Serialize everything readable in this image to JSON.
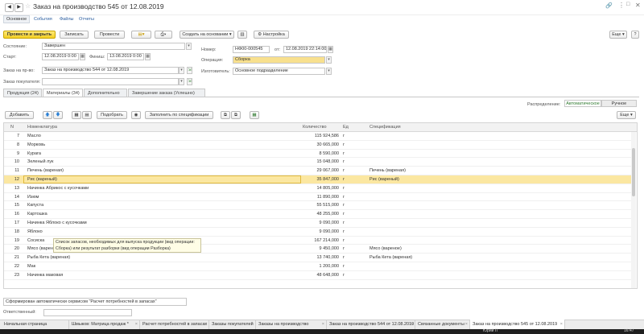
{
  "window": {
    "title": "Заказ на производство 545 от 12.08.2019"
  },
  "nav_tabs": [
    "Основное",
    "События",
    "Файлы",
    "Отчеты"
  ],
  "toolbar": {
    "post_close": "Провести и закрыть",
    "save": "Записать",
    "post": "Провести",
    "create_based": "Создать на основании",
    "settings": "Настройка",
    "more": "Еще"
  },
  "form": {
    "state_label": "Состояние:",
    "state_value": "Завершен",
    "start_label": "Старт:",
    "start_value": "12.08.2019  0:00",
    "finish_label": "Финиш:",
    "finish_value": "13.08.2019  0:00",
    "order_label": "Заказ на пр-во:",
    "order_value": "Заказ на производство 544 от 12.08.2019",
    "buyer_label": "Заказ покупателя:",
    "buyer_value": "",
    "number_label": "Номер:",
    "number_value": "НФ00-000545",
    "from_label": "от:",
    "from_value": "12.08.2019 22:14:00",
    "operation_label": "Операция:",
    "operation_value": "Сборка",
    "maker_label": "Изготовитель:",
    "maker_value": "Основное подразделение"
  },
  "content_tabs": [
    "Продукция (24)",
    "Материалы (34)",
    "Дополнительно",
    "Завершение заказа (Успешно)"
  ],
  "distribution": {
    "label": "Распределение:",
    "auto": "Автоматическое",
    "manual": "Ручное"
  },
  "table_toolbar": {
    "add": "Добавить",
    "pick": "Подобрать",
    "fill_spec": "Заполнить по спецификации",
    "more": "Еще"
  },
  "table": {
    "headers": {
      "n": "N",
      "name": "Номенклатура",
      "qty": "Количество",
      "unit": "Ед",
      "spec": "Спецификация"
    },
    "rows": [
      {
        "n": "7",
        "name": "Масло",
        "qty": "115 924,586",
        "unit": "г",
        "spec": ""
      },
      {
        "n": "8",
        "name": "Морковь",
        "qty": "30 665,000",
        "unit": "г",
        "spec": ""
      },
      {
        "n": "9",
        "name": "Курага",
        "qty": "8 590,000",
        "unit": "г",
        "spec": ""
      },
      {
        "n": "10",
        "name": "Зеленый лук",
        "qty": "15 048,000",
        "unit": "г",
        "spec": ""
      },
      {
        "n": "11",
        "name": "Печень (вареная)",
        "qty": "29 067,000",
        "unit": "г",
        "spec": "Печень (вареная)"
      },
      {
        "n": "12",
        "name": "Рис (вареный)",
        "qty": "35 847,000",
        "unit": "г",
        "spec": "Рис (вареный)",
        "selected": true
      },
      {
        "n": "13",
        "name": "Начинка Абрикос с кусочками",
        "qty": "14 805,000",
        "unit": "г",
        "spec": ""
      },
      {
        "n": "14",
        "name": "Изюм",
        "qty": "11 890,000",
        "unit": "г",
        "spec": ""
      },
      {
        "n": "15",
        "name": "Капуста",
        "qty": "55 515,000",
        "unit": "г",
        "spec": ""
      },
      {
        "n": "16",
        "name": "Картошка",
        "qty": "48 255,000",
        "unit": "г",
        "spec": ""
      },
      {
        "n": "17",
        "name": "Начинка Яблоко с кусочками",
        "qty": "9 090,000",
        "unit": "г",
        "spec": ""
      },
      {
        "n": "18",
        "name": "Яблоко",
        "qty": "9 090,000",
        "unit": "г",
        "spec": ""
      },
      {
        "n": "19",
        "name": "Сосиска",
        "qty": "167 214,000",
        "unit": "г",
        "spec": ""
      },
      {
        "n": "20",
        "name": "Мясо (вареное)",
        "qty": "9 450,000",
        "unit": "г",
        "spec": "Мясо (вареное)"
      },
      {
        "n": "21",
        "name": "Рыба Кета (вареная)",
        "qty": "13 740,000",
        "unit": "г",
        "spec": "Рыба Кета (вареная)"
      },
      {
        "n": "22",
        "name": "Мак",
        "qty": "1 200,000",
        "unit": "г",
        "spec": ""
      },
      {
        "n": "23",
        "name": "Начинка маковая",
        "qty": "48 648,000",
        "unit": "г",
        "spec": ""
      }
    ]
  },
  "tooltip": {
    "line1": "Список запасов, необходимых для выпуска продукции (вид операции:",
    "line2": "Сборка) или результат разборки (вид операции Разборка)"
  },
  "footer": {
    "comment": "Сформирован автоматически сервисом \"Расчет потребностей в запасах\"",
    "author_label": "Ответственный:",
    "author_value": ""
  },
  "taskbar": [
    "Начальная страница",
    "Шмыков: Матрица продаж *",
    "Расчет потребностей в запасах",
    "Заказы покупателей",
    "Заказы на производство",
    "Заказ на производство 544 от 12.08.2019",
    "Связанные документы",
    "Заказ на производство 545 от 12.08.2019"
  ],
  "system_tray": {
    "time": "16:47",
    "user": "Юрий П"
  },
  "colors": {
    "accent_yellow": "#f3cf24",
    "selected_row": "#fbe7a1",
    "link_blue": "#2a5d9f"
  }
}
